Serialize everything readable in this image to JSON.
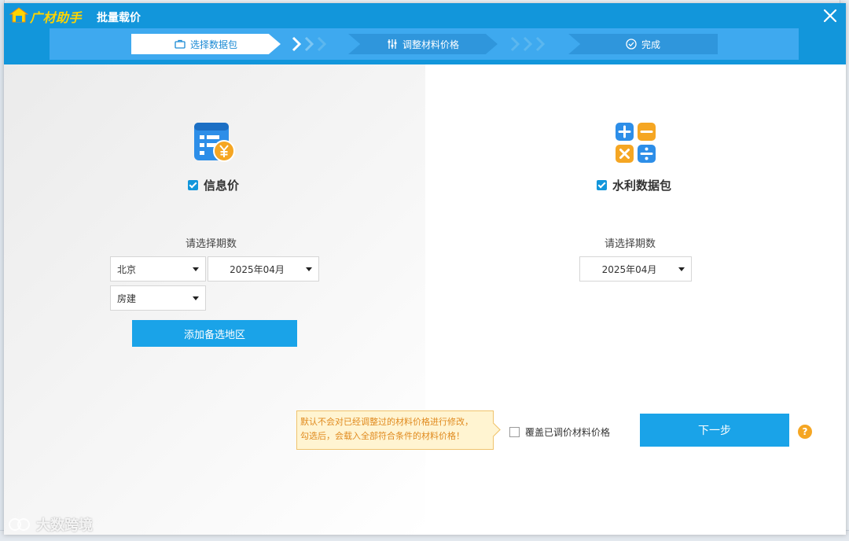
{
  "app": {
    "name": "广材助手",
    "dialog_title": "批量载价"
  },
  "steps": [
    {
      "label": "选择数据包",
      "icon": "briefcase-icon",
      "active": true
    },
    {
      "label": "调整材料价格",
      "icon": "sliders-icon",
      "active": false
    },
    {
      "label": "完成",
      "icon": "check-circle-icon",
      "active": false
    }
  ],
  "left": {
    "icon": "price-document-icon",
    "checkbox_label": "信息价",
    "checked": true,
    "period_label": "请选择期数",
    "region": "北京",
    "period": "2025年04月",
    "category": "房建",
    "add_region_button": "添加备选地区"
  },
  "right": {
    "icon": "calculator-icon",
    "checkbox_label": "水利数据包",
    "checked": true,
    "period_label": "请选择期数",
    "period": "2025年04月"
  },
  "footer": {
    "tooltip_line1": "默认不会对已经调整过的材料价格进行修改，",
    "tooltip_line2": "勾选后，会载入全部符合条件的材料价格！",
    "override_label": "覆盖已调价材料价格",
    "override_checked": false,
    "next_button": "下一步",
    "help_icon": "?"
  },
  "watermark": "大数跨境",
  "colors": {
    "primary": "#1296db",
    "button": "#1aa3e8",
    "warning_text": "#e08a1e",
    "brand_yellow": "#ffd400"
  }
}
